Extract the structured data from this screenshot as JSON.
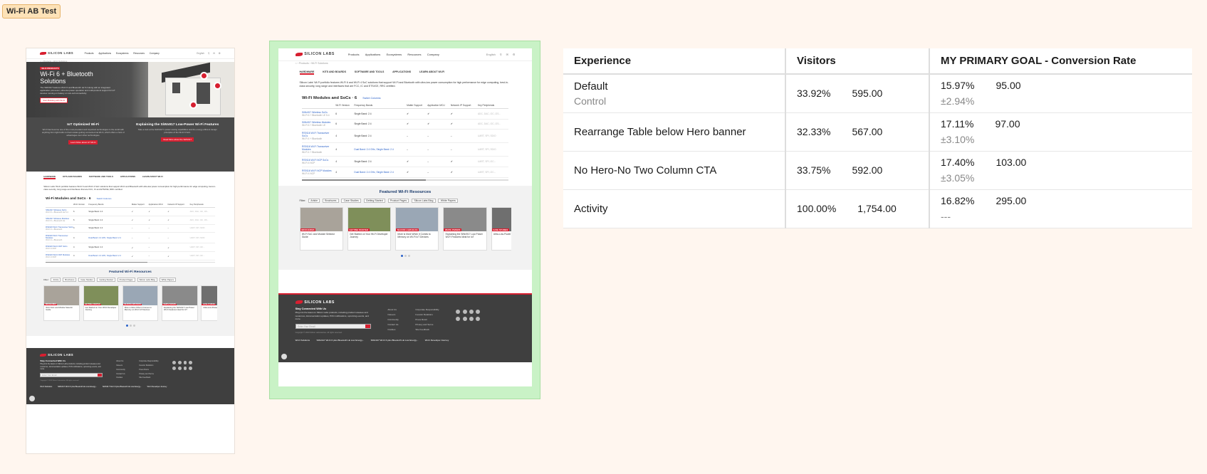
{
  "tag": "Wi-Fi AB Test",
  "page": {
    "logo": "SILICON LABS",
    "nav": [
      "Products",
      "Applications",
      "Ecosystems",
      "Resources",
      "Company"
    ],
    "tools": [
      "English",
      "⚲",
      "✉",
      "⚙"
    ],
    "breadcrumb": "⌂ › Products › Wi-Fi Solutions",
    "hero_badge": "WI-FI PRODUCTS",
    "hero_title": "Wi-Fi 6 + Bluetooth Solutions",
    "hero_text": "The SiWx917 features Wi-Fi 6 and Bluetooth LE 5.4 along with an integrated application processor, ultra-low-power operation and multi-protocol support for IoT devices running on battery or coin-cell connectivity.",
    "hero_cta": "Start Building with Wi-Fi",
    "col1_title": "IoT Optimized Wi-Fi",
    "col1_text": "Wi-Fi has become one of the most prevalent and important technologies in the world with anything from light bulbs to thermostats getting connected via Wi-Fi, which offers a host of advantages over other technologies.",
    "col1_btn": "Learn More about IoT Wi-Fi",
    "col2_title": "Explaining the SiWx917 Low-Power Wi-Fi Features",
    "col2_text": "Take a look at the SiWx917's power-saving capabilities and the energy-efficient design principles of the Wi-Fi 6 SoC.",
    "col2_btn": "Read More about the SiWx917",
    "tabs": [
      "HARDWARE",
      "KITS AND BOARDS",
      "SOFTWARE AND TOOLS",
      "APPLICATIONS",
      "LEARN ABOUT WI-FI"
    ],
    "intro": "Silicon Labs' Wi-Fi portfolio features Wi-Fi 6 and Wi-Fi 4 SoC solutions that support Wi-Fi and Bluetooth with ultra-low power consumption for high performance for edge computing, best-in-class security, long range and interfaces that are FCC, IC and ETSI/CE, RRC certified.",
    "section_title": "Wi-Fi Modules and SoCs · 6",
    "section_link": "Switch Columns",
    "table_headers": [
      "Wi-Fi Version",
      "Frequency Bands",
      "Matter Support",
      "Application MCU",
      "Network IP Support",
      "Key Peripherals"
    ],
    "table_rows": [
      {
        "name": "SiWx917 Wireless SoCs",
        "sub": "Wi-Fi 6 + Bluetooth LE 5.4",
        "ver": "6",
        "freq": "Single Band: 2.4",
        "m": "✔",
        "a": "✔",
        "n": "✔",
        "p": "ADC, DAC, I2C, I2S..."
      },
      {
        "name": "SiWx917 Wireless Modules",
        "sub": "Wi-Fi 6 + Bluetooth LE",
        "ver": "6",
        "freq": "Single Band: 2.4",
        "m": "✔",
        "a": "✔",
        "n": "✔",
        "p": "ADC, DAC, I2C, I2S..."
      },
      {
        "name": "RS9116 Wi-Fi Transceiver SoCs",
        "sub": "Wi-Fi 4 + Bluetooth",
        "ver": "4",
        "freq": "Single Band: 2.4",
        "m": "–",
        "a": "–",
        "n": "–",
        "p": "UART, SPI, SDIO"
      },
      {
        "name": "RS9116 Wi-Fi Transceiver Modules",
        "sub": "Wi-Fi 4 + Bluetooth",
        "ver": "4",
        "freq": "Dual Band: 2.4 GHz, Single Band: 2.4",
        "m": "–",
        "a": "–",
        "n": "–",
        "p": "UART, SPI, SDIO"
      },
      {
        "name": "RS9116 Wi-Fi NCP SoCs",
        "sub": "Wi-Fi 4 NCP",
        "ver": "4",
        "freq": "Single Band: 2.4",
        "m": "✔",
        "a": "–",
        "n": "✔",
        "p": "UART, SPI, I2C..."
      },
      {
        "name": "RS9116 Wi-Fi NCP Modules",
        "sub": "Wi-Fi 4 NCP",
        "ver": "4",
        "freq": "Dual Band: 2.4 GHz, Single Band: 2.4",
        "m": "✔",
        "a": "–",
        "n": "✔",
        "p": "UART, SPI, I2C..."
      }
    ],
    "resources_title": "Featured Wi-Fi Resources",
    "filter_label": "Filter:",
    "filters": [
      "Article",
      "Brochures",
      "Case Studies",
      "Getting Started",
      "Product Pages",
      "Silicon Labs Blog",
      "White Papers"
    ],
    "cards": [
      {
        "cat": "BROCHURES",
        "title": "Wi-Fi SoC and Module Selector Guide",
        "bg": "#a9a39a"
      },
      {
        "cat": "GETTING STARTED",
        "title": "Get Started on Your Wi-Fi Developer Journey",
        "bg": "#7f8f5a"
      },
      {
        "cat": "SILICON LABS BLOG",
        "title": "More is More When it Comes to Memory on Wi-Fi IoT Devices",
        "bg": "#9aa7b5"
      },
      {
        "cat": "WHITE PAPERS",
        "title": "Explaining the SiWx917 Low-Power Wi-Fi Features Ideal for IoT",
        "bg": "#8a8a8a"
      },
      {
        "cat": "CASE STUDIES",
        "title": "Ultra-Low-Power Wi-Fi Cloud",
        "bg": "#6f6f6f"
      }
    ],
    "footer_logo": "SILICON LABS",
    "footer_heading": "Stay Connected With Us",
    "footer_text": "Plug into the latest on Silicon Labs products, including product releases and resources, documentation updates, PCN notifications, upcoming events, and more.",
    "footer_email": "Enter Your Email",
    "footer_links1": [
      "About Us",
      "Careers",
      "Community",
      "Contact Us",
      "Cookies"
    ],
    "footer_links2": [
      "Corporate Responsibility",
      "Investor Relations",
      "Press Room",
      "Privacy and Terms",
      "Site Feedback"
    ],
    "footer_copyright": "Copyright © 2024 Silicon Laboratories. All rights reserved.",
    "footer_bottom": [
      "Wi-Fi Solutions",
      "SiWx917 Wi-Fi 6 plus Bluetooth LE Low Energy...",
      "SiWx917 Wi-Fi 6 plus Bluetooth LE Low Energy...",
      "Wi-Fi Developer Journey"
    ]
  },
  "results": {
    "headers": [
      "Experience",
      "Visitors",
      "MY PRIMARY GOAL - Conversion Rate"
    ],
    "rows": [
      {
        "name": "Default",
        "sub": "Control",
        "visit_pct": "33.92%",
        "visitors": "595.00",
        "conv_pct": "15.97%",
        "conv": "95.00",
        "ci": "±2.94%"
      },
      {
        "name": "Rearrange Table below Hero banner",
        "sub": "",
        "visit_pct": "32.33%",
        "visitors": "567.00",
        "conv_pct": "17.11%",
        "conv": "97.00",
        "ci": "±3.10%"
      },
      {
        "name": "No Hero-No Two Column CTA",
        "sub": "",
        "visit_pct": "33.75%",
        "visitors": "592.00",
        "conv_pct": "17.40%",
        "conv": "103.00",
        "ci": "±3.05%"
      },
      {
        "name": "Activity",
        "sub": "",
        "visit_pct": "100.00%",
        "visitors": "1,754.00",
        "conv_pct": "16.82%",
        "conv": "295.00",
        "ci": "---"
      }
    ]
  }
}
